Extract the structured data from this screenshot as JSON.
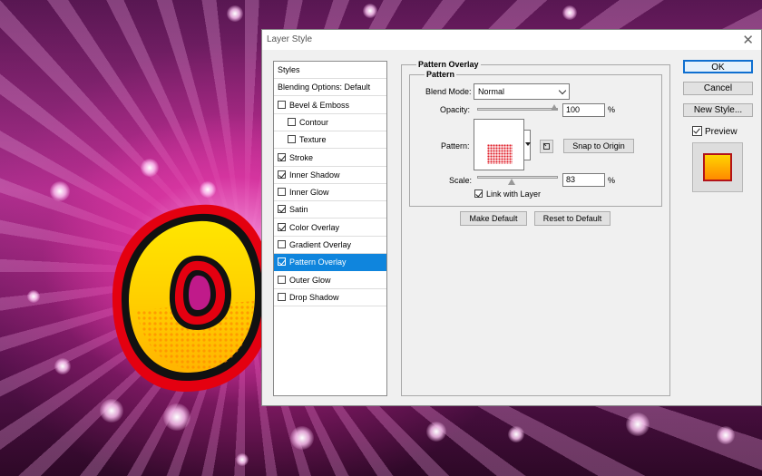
{
  "dialog": {
    "title": "Layer Style",
    "close_glyph": "✕"
  },
  "styles_list": {
    "items": [
      {
        "label": "Styles",
        "type": "header"
      },
      {
        "label": "Blending Options: Default",
        "type": "header"
      },
      {
        "label": "Bevel & Emboss",
        "checked": false,
        "indent": 0
      },
      {
        "label": "Contour",
        "checked": false,
        "indent": 1
      },
      {
        "label": "Texture",
        "checked": false,
        "indent": 1
      },
      {
        "label": "Stroke",
        "checked": true,
        "indent": 0
      },
      {
        "label": "Inner Shadow",
        "checked": true,
        "indent": 0
      },
      {
        "label": "Inner Glow",
        "checked": false,
        "indent": 0
      },
      {
        "label": "Satin",
        "checked": true,
        "indent": 0
      },
      {
        "label": "Color Overlay",
        "checked": true,
        "indent": 0
      },
      {
        "label": "Gradient Overlay",
        "checked": false,
        "indent": 0
      },
      {
        "label": "Pattern Overlay",
        "checked": true,
        "indent": 0,
        "selected": true
      },
      {
        "label": "Outer Glow",
        "checked": false,
        "indent": 0
      },
      {
        "label": "Drop Shadow",
        "checked": false,
        "indent": 0
      }
    ]
  },
  "pattern_overlay": {
    "section_title": "Pattern Overlay",
    "group_title": "Pattern",
    "blend_mode_label": "Blend Mode:",
    "blend_mode_value": "Normal",
    "opacity_label": "Opacity:",
    "opacity_value": "100",
    "opacity_level": 1.0,
    "percent": "%",
    "pattern_label": "Pattern:",
    "snap_to_origin": "Snap to Origin",
    "scale_label": "Scale:",
    "scale_value": "83",
    "scale_level": 0.42,
    "link_with_layer_label": "Link with Layer",
    "link_with_layer_checked": true,
    "make_default": "Make Default",
    "reset_to_default": "Reset to Default"
  },
  "actions": {
    "ok": "OK",
    "cancel": "Cancel",
    "new_style": "New Style...",
    "preview_label": "Preview",
    "preview_checked": true
  },
  "colors": {
    "selection": "#0f85dd",
    "swatch_top": "#ffd400",
    "swatch_bottom": "#ff8a00",
    "swatch_border": "#b31318"
  },
  "icons": {
    "new_preset": "new-preset-icon",
    "close": "close-icon"
  }
}
